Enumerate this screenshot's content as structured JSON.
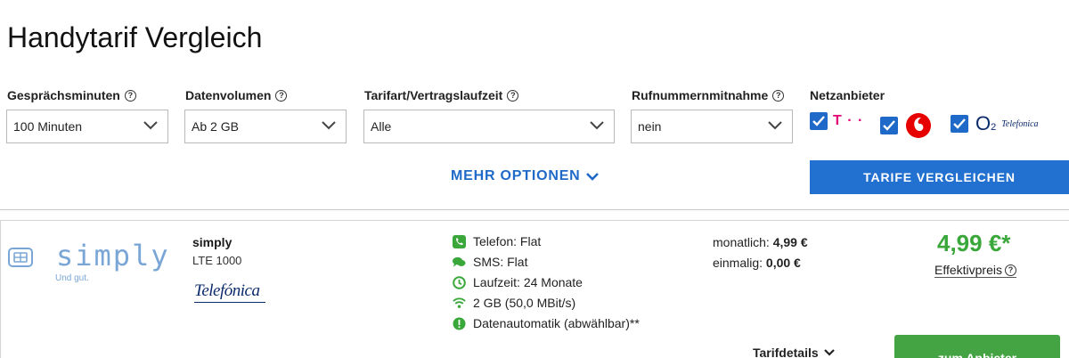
{
  "page": {
    "title": "Handytarif Vergleich"
  },
  "filters": [
    {
      "label": "Gesprächsminuten",
      "value": "100 Minuten"
    },
    {
      "label": "Datenvolumen",
      "value": "Ab 2 GB"
    },
    {
      "label": "Tarifart/Vertragslaufzeit",
      "value": "Alle"
    },
    {
      "label": "Rufnummernmitnahme",
      "value": "nein"
    }
  ],
  "network": {
    "label": "Netzanbieter",
    "providers": [
      {
        "name": "T · ·",
        "checked": true,
        "color": "#e20074"
      },
      {
        "name": "Vodafone",
        "checked": true,
        "color": "#e60000"
      },
      {
        "name": "O2",
        "sub": "Telefonica",
        "checked": true,
        "color": "#0a2a6b"
      }
    ]
  },
  "actions": {
    "more_options": "MEHR OPTIONEN",
    "compare": "TARIFE VERGLEICHEN"
  },
  "offer": {
    "logo_text": "simply",
    "logo_slogan": "Und gut.",
    "provider": "simply",
    "tariff": "LTE 1000",
    "network_logo": "Telefónica",
    "features": [
      {
        "icon": "phone-icon",
        "text": "Telefon: Flat"
      },
      {
        "icon": "sms-icon",
        "text": "SMS: Flat"
      },
      {
        "icon": "clock-icon",
        "text": "Laufzeit: 24 Monate"
      },
      {
        "icon": "wifi-icon",
        "text": "2 GB (50,0 MBit/s)"
      },
      {
        "icon": "info-icon",
        "text": "Datenautomatik (abwählbar)**"
      }
    ],
    "monthly_label": "monatlich:",
    "monthly_value": "4,99 €",
    "onetime_label": "einmalig:",
    "onetime_value": "0,00 €",
    "price": "4,99 €*",
    "effective_label": "Effektivpreis",
    "details_label": "Tarifdetails",
    "cta": "zum Anbieter"
  },
  "colors": {
    "accent": "#2270d0",
    "cta_green": "#44a444",
    "price_green": "#3aa73a",
    "icon_green": "#3aa73a"
  }
}
